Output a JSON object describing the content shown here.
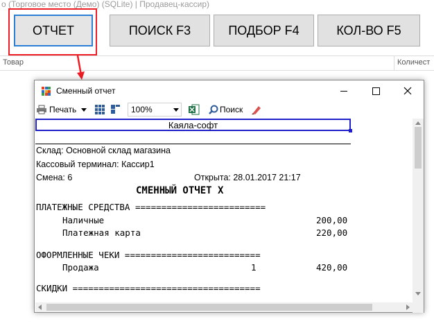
{
  "background": {
    "window_title": "о (Торговое место (Демо) (SQLite) | Продавец-кассир)",
    "buttons": {
      "report": "ОТЧЕТ",
      "search": "ПОИСК F3",
      "pick": "ПОДБОР F4",
      "qty": "КОЛ-ВО F5"
    },
    "columns": {
      "product": "Товар",
      "quantity": "Количест"
    }
  },
  "dialog": {
    "title": "Сменный отчет",
    "toolbar": {
      "print": "Печать",
      "zoom": "100%",
      "find": "Поиск"
    },
    "report": {
      "company": "Каяла-софт",
      "warehouse": "Склад: Основной склад магазина",
      "terminal": "Кассовый терминал: Кассир1",
      "shift": "Смена: 6",
      "opened": "Открыта: 28.01.2017 21:17",
      "heading": "СМЕННЫЙ ОТЧЕТ Х",
      "payments_header": "ПЛАТЕЖНЫЕ СРЕДСТВА =========================",
      "payments": [
        {
          "label": "Наличные",
          "amount": "200,00"
        },
        {
          "label": "Платежная карта",
          "amount": "220,00"
        }
      ],
      "checks_header": "ОФОРМЛЕННЫЕ ЧЕКИ ==========================",
      "checks": [
        {
          "label": "Продажа",
          "count": "1",
          "amount": "420,00"
        }
      ],
      "discounts_header": "СКИДКИ ===================================="
    }
  },
  "colors": {
    "highlight_red": "#ee1c24",
    "focus_blue": "#2a7fd4",
    "selection_blue": "#1e1ecb",
    "excel_green": "#1d7044"
  }
}
